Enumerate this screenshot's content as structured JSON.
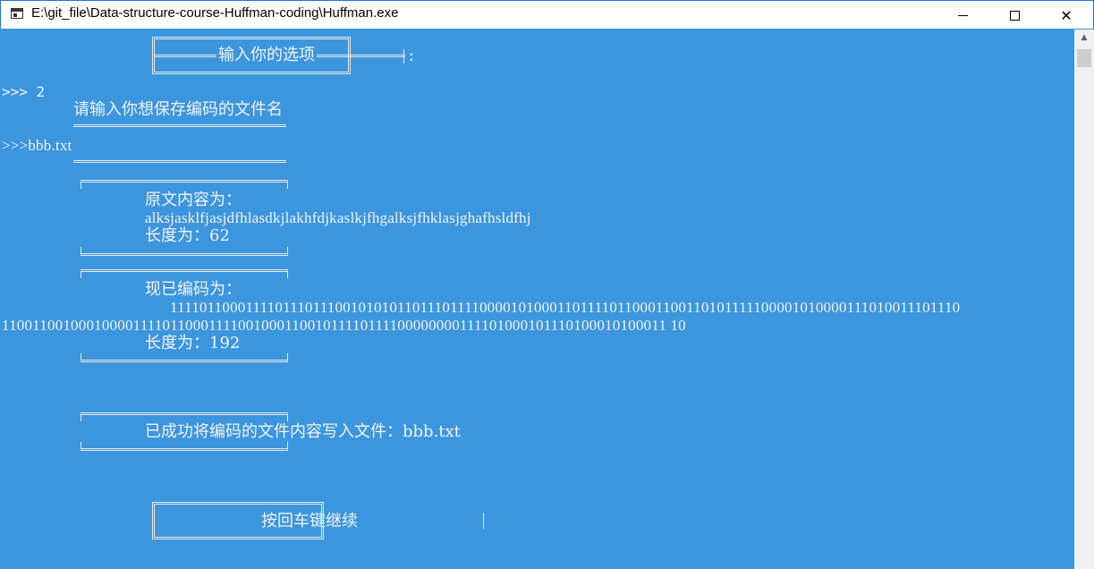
{
  "window": {
    "title": "E:\\git_file\\Data-structure-course-Huffman-coding\\Huffman.exe",
    "icon": "console-app-icon",
    "controls": {
      "minimize": "minimize-icon",
      "maximize": "maximize-icon",
      "close": "✕"
    }
  },
  "console": {
    "menu_header": "输入你的选项",
    "menu_colon": ":",
    "prompt_choice": ">>> 2",
    "filename_prompt": "请输入你想保存编码的文件名",
    "filename_input": ">>>bbb.txt",
    "original": {
      "label": "原文内容为：",
      "content": "alksjasklfjasjdfhlasdkjlakhfdjkaslkjfhgalksjfhklasjghafhsldfhj",
      "length": "长度为：62"
    },
    "encoded": {
      "label": "现已编码为：",
      "line1": "11110110001111011101110010101011011101111000010100011011110110001100110101111100001010000111010011101110",
      "line2": "110011001000100001111011000111100100011001011110111100000000111101000101110100010100011 10",
      "length": "长度为：192"
    },
    "success_message": "已成功将编码的文件内容写入文件：bbb.txt",
    "continue_prompt": "按回车键继续"
  },
  "colors": {
    "console_bg": "#3c96dd",
    "console_text": "#f2f2f2",
    "titlebar_bg": "#ffffff"
  }
}
